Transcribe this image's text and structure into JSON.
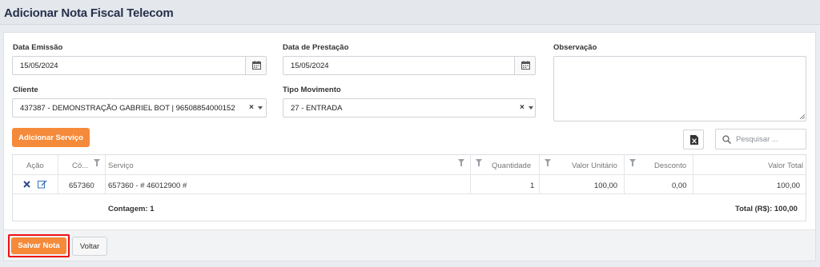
{
  "page": {
    "title": "Adicionar Nota Fiscal Telecom"
  },
  "form": {
    "data_emissao": {
      "label": "Data Emissão",
      "value": "15/05/2024",
      "icon": "calendar-icon"
    },
    "data_prestacao": {
      "label": "Data de Prestação",
      "value": "15/05/2024",
      "icon": "calendar-icon"
    },
    "observacao": {
      "label": "Observação",
      "value": ""
    },
    "cliente": {
      "label": "Cliente",
      "value": "437387 - DEMONSTRAÇÃO GABRIEL BOT | 96508854000152",
      "clear": "×"
    },
    "tipo_movimento": {
      "label": "Tipo Movimento",
      "value": "27 - ENTRADA",
      "clear": "×"
    }
  },
  "toolbar": {
    "add_service_label": "Adicionar Serviço",
    "export_icon": "excel-icon",
    "search_placeholder": "Pesquisar ...",
    "search_icon": "search-icon"
  },
  "grid": {
    "columns": [
      "Ação",
      "Có...",
      "Serviço",
      "Quantidade",
      "Valor Unitário",
      "Desconto",
      "Valor Total"
    ],
    "rows": [
      {
        "codigo": "657360",
        "servico": "657360 - # 46012900 #",
        "quantidade": "1",
        "valor_unitario": "100,00",
        "desconto": "0,00",
        "valor_total": "100,00"
      }
    ],
    "summary": {
      "count": "Contagem: 1",
      "total": "Total (R$): 100,00"
    }
  },
  "footer": {
    "save_label": "Salvar Nota",
    "back_label": "Voltar"
  },
  "colors": {
    "accent": "#f58a3a",
    "highlight": "#e11111"
  }
}
